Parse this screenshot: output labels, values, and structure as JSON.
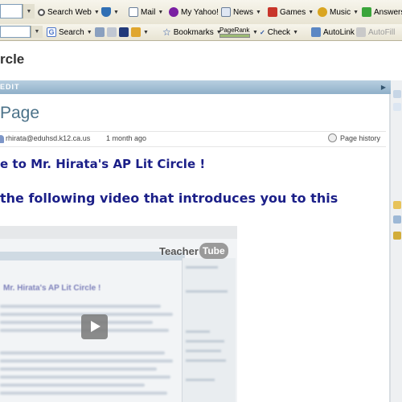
{
  "toolbar1": {
    "search_web": "Search Web",
    "mail": "Mail",
    "my_yahoo": "My Yahoo!",
    "news": "News",
    "games": "Games",
    "music": "Music",
    "answers": "Answers"
  },
  "toolbar2": {
    "search": "Search",
    "bookmarks": "Bookmarks",
    "pagerank": "PageRank",
    "check": "Check",
    "autolink": "AutoLink",
    "autofill": "AutoFill"
  },
  "page": {
    "heading": "rcle",
    "edit_label": "EDIT",
    "title": "Page",
    "author": "rhirata@eduhsd.k12.ca.us",
    "age": "1 month ago",
    "history": "Page history",
    "welcome": "e to Mr. Hirata's AP Lit Circle !",
    "instruction": "the following video that introduces you to this"
  },
  "video": {
    "logo_teacher": "Teacher",
    "logo_tube": "Tube",
    "inner_title": "Mr. Hirata's AP Lit Circle !"
  },
  "colors": {
    "accent_blue": "#8fb0c9",
    "heading_navy": "#1b1f88",
    "title_blue": "#4b7289"
  }
}
